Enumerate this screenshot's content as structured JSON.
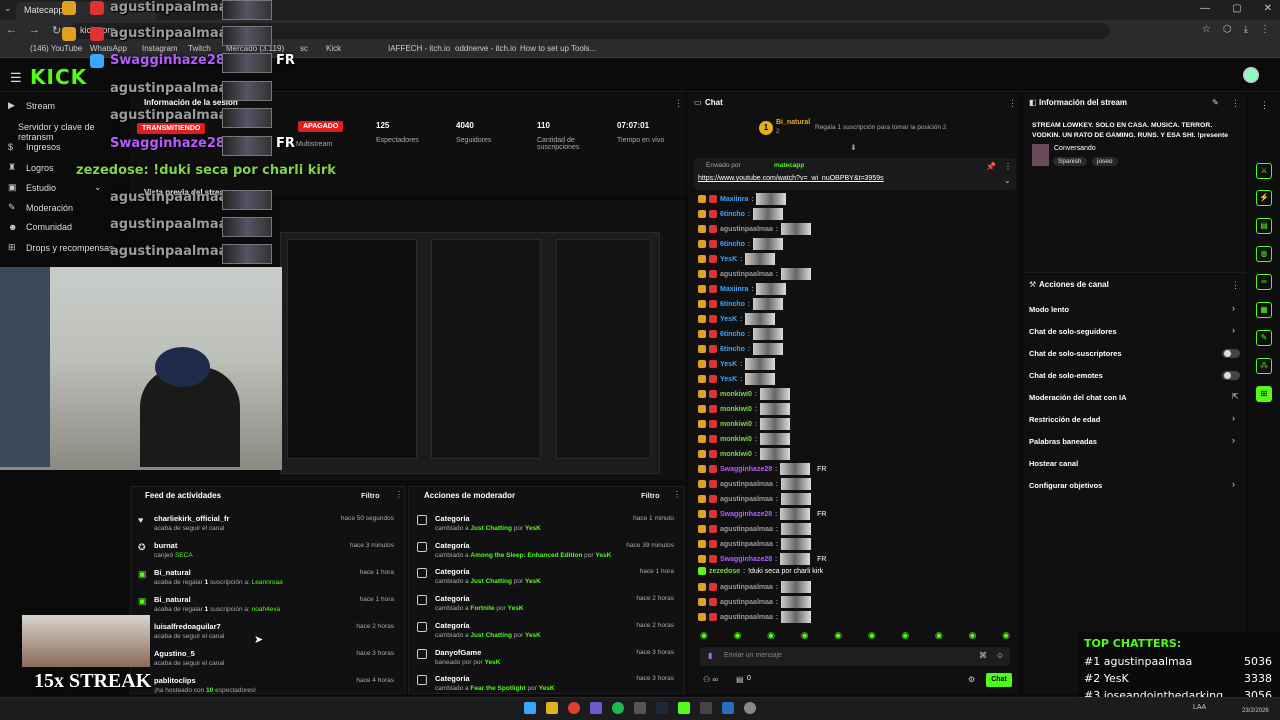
{
  "browser": {
    "tab_title": "Matecapp",
    "url_text": "kick.com",
    "bookmarks": [
      "(146) YouTube",
      "WhatsApp",
      "Instagram",
      "Twitch",
      "Mercado (3.119)",
      "sc",
      "Kick",
      "IAFFECH - itch.io",
      "oddnerve - itch.io",
      "How to set up Tools..."
    ]
  },
  "kick": {
    "logo": "KICK"
  },
  "sidebar": {
    "items": [
      {
        "label": "Stream",
        "icon": "stream-icon"
      },
      {
        "label": "Servidor y clave de retransm",
        "icon": ""
      },
      {
        "label": "Ingresos",
        "icon": "money-icon"
      },
      {
        "label": "Logros",
        "icon": "trophy-icon"
      },
      {
        "label": "Estudio",
        "icon": "studio-icon"
      },
      {
        "label": "Moderación",
        "icon": "wrench-icon"
      },
      {
        "label": "Comunidad",
        "icon": "users-icon"
      },
      {
        "label": "Drops y recompensas",
        "icon": "gift-icon"
      }
    ]
  },
  "session": {
    "title": "Información de la sesión",
    "status_live": "TRANSMITIENDO",
    "multistream_status": "APAGADO",
    "multistream_label": "Multistream",
    "stats": [
      {
        "value": "125",
        "label": "Espectadores"
      },
      {
        "value": "4040",
        "label": "Seguidores"
      },
      {
        "value": "110",
        "label": "Cantidad de suscripciones"
      },
      {
        "value": "07:07:01",
        "label": "Tiempo en vivo"
      }
    ],
    "preview_title": "Vista previa del stream"
  },
  "overlay": {
    "names": [
      "agustinpaalmaa:",
      "agustinpaalmaa:",
      "Swagginhaze28:",
      "agustinpaalmaa:",
      "agustinpaalmaa:",
      "Swagginhaze28:",
      "zezedose: !duki seca por charli kirk",
      "agustinpaalmaa:",
      "agustinpaalmaa:",
      "agustinpaalmaa:"
    ],
    "fr": "FR",
    "streak": "15x STREAK"
  },
  "activity": {
    "title": "Feed de actividades",
    "filter": "Filtro",
    "items": [
      {
        "name": "charliekirk_official_fr",
        "sub": "acaba de seguir el canal",
        "time": "hace 50 segundos",
        "icon": "heart-icon"
      },
      {
        "name": "burnat",
        "sub_pre": "canjeó",
        "sub_hl": "SECA",
        "time": "hace 3 minutos",
        "icon": "reward-icon"
      },
      {
        "name": "Bi_natural",
        "sub_pre": "acaba de regalar",
        "sub_num": "1",
        "sub_mid": "suscripción a:",
        "sub_hl": "Leannroaa",
        "time": "hace 1 hora",
        "icon": "gift-icon"
      },
      {
        "name": "Bi_natural",
        "sub_pre": "acaba de regalar",
        "sub_num": "1",
        "sub_mid": "suscripción a:",
        "sub_hl": "noah4eva",
        "time": "hace 1 hora",
        "icon": "gift-icon"
      },
      {
        "name": "luisalfredoaguilar7",
        "sub": "acaba de seguir el canal",
        "time": "hace 2 horas",
        "icon": "heart-icon"
      },
      {
        "name": "Agustino_5",
        "sub": "acaba de seguir el canal",
        "time": "hace 3 horas",
        "icon": "heart-icon"
      },
      {
        "name": "pablitoclips",
        "sub_pre": "¡ha hosteado con",
        "sub_num": "10",
        "sub_mid": "espectadores!",
        "time": "hace 4 horas",
        "icon": "host-icon"
      }
    ]
  },
  "modactions": {
    "title": "Acciones de moderador",
    "filter": "Filtro",
    "items": [
      {
        "title": "Categoría",
        "pre": "cambiado a",
        "hl": "Just Chatting",
        "by": "YesK",
        "time": "hace 1 minuto"
      },
      {
        "title": "Categoría",
        "pre": "cambiado a",
        "hl": "Among the Sleep: Enhanced Edition",
        "by": "YesK",
        "time": "hace 39 minutos"
      },
      {
        "title": "Categoría",
        "pre": "cambiado a",
        "hl": "Just Chatting",
        "by": "YesK",
        "time": "hace 1 hora"
      },
      {
        "title": "Categoría",
        "pre": "cambiado a",
        "hl": "Fortnite",
        "by": "YesK",
        "time": "hace 2 horas"
      },
      {
        "title": "Categoría",
        "pre": "cambiado a",
        "hl": "Just Chatting",
        "by": "YesK",
        "time": "hace 2 horas"
      },
      {
        "title": "DanyofGame",
        "pre": "baneado por",
        "hl": "",
        "by": "YesK",
        "time": "hace 3 horas"
      },
      {
        "title": "Categoría",
        "pre": "cambiado a",
        "hl": "Fear the Spotlight",
        "by": "YesK",
        "time": "hace 3 horas"
      }
    ]
  },
  "chat": {
    "title": "Chat",
    "gifter_name": "Bi_natural",
    "gifter_count": "2",
    "gift_prompt": "Regala 1 suscripción para tomar la posición 2",
    "pinned_by_pre": "Enviado por",
    "pinned_by": "matecapp",
    "pinned_link": "https://www.youtube.com/watch?v=_wi_nuOBPBY&t=3959s",
    "messages": [
      {
        "user": "Maxiinra",
        "color": "#3aa7ff",
        "fr": false
      },
      {
        "user": "6tincho",
        "color": "#3aa7ff",
        "fr": false
      },
      {
        "user": "agustinpaalmaa",
        "color": "#9b9b9b",
        "fr": false
      },
      {
        "user": "6tincho",
        "color": "#3aa7ff",
        "fr": false
      },
      {
        "user": "YesK",
        "color": "#3aa7ff",
        "fr": false
      },
      {
        "user": "agustinpaalmaa",
        "color": "#9b9b9b",
        "fr": false
      },
      {
        "user": "Maxiinra",
        "color": "#3aa7ff",
        "fr": false
      },
      {
        "user": "6tincho",
        "color": "#3aa7ff",
        "fr": false
      },
      {
        "user": "YesK",
        "color": "#3aa7ff",
        "fr": false
      },
      {
        "user": "6tincho",
        "color": "#3aa7ff",
        "fr": false
      },
      {
        "user": "6tincho",
        "color": "#3aa7ff",
        "fr": false
      },
      {
        "user": "YesK",
        "color": "#3aa7ff",
        "fr": false
      },
      {
        "user": "YesK",
        "color": "#3aa7ff",
        "fr": false
      },
      {
        "user": "monkiwi0",
        "color": "#7fd64a",
        "fr": false
      },
      {
        "user": "monkiwi0",
        "color": "#7fd64a",
        "fr": false
      },
      {
        "user": "monkiwi0",
        "color": "#7fd64a",
        "fr": false
      },
      {
        "user": "monkiwi0",
        "color": "#7fd64a",
        "fr": false
      },
      {
        "user": "monkiwi0",
        "color": "#7fd64a",
        "fr": false
      },
      {
        "user": "Swagginhaze28",
        "color": "#b75cff",
        "fr": true
      },
      {
        "user": "agustinpaalmaa",
        "color": "#9b9b9b",
        "fr": false
      },
      {
        "user": "agustinpaalmaa",
        "color": "#9b9b9b",
        "fr": false
      },
      {
        "user": "Swagginhaze28",
        "color": "#b75cff",
        "fr": true
      },
      {
        "user": "agustinpaalmaa",
        "color": "#9b9b9b",
        "fr": false
      },
      {
        "user": "agustinpaalmaa",
        "color": "#9b9b9b",
        "fr": false
      },
      {
        "user": "Swagginhaze28",
        "color": "#b75cff",
        "fr": true
      }
    ],
    "last_msg_user": "zezedose",
    "last_msg_text": "!duki seca por charli kirk",
    "after": [
      {
        "user": "agustinpaalmaa",
        "color": "#9b9b9b"
      },
      {
        "user": "agustinpaalmaa",
        "color": "#9b9b9b"
      },
      {
        "user": "agustinpaalmaa",
        "color": "#9b9b9b"
      }
    ],
    "input_placeholder": "Enviar un mensaje",
    "points": "0",
    "send_label": "Chat"
  },
  "stream_info": {
    "title": "Información del stream",
    "description": "STREAM LOWKEY. SOLO EN CASA. MUSICA. TERROR. VODKIN. UN RATO DE GAMING. RUNS. Y ESA SHI. !presente",
    "category": "Conversando",
    "tags": [
      "Spanish",
      "joseo"
    ]
  },
  "channel_actions": {
    "title": "Acciones de canal",
    "items": [
      {
        "label": "Modo lento",
        "control": "arrow"
      },
      {
        "label": "Chat de solo-seguidores",
        "control": "arrow"
      },
      {
        "label": "Chat de solo-suscriptores",
        "control": "toggle"
      },
      {
        "label": "Chat de solo-emotes",
        "control": "toggle"
      },
      {
        "label": "Moderación del chat con IA",
        "control": "external"
      },
      {
        "label": "Restricción de edad",
        "control": "arrow"
      },
      {
        "label": "Palabras baneadas",
        "control": "arrow"
      },
      {
        "label": "Hostear canal",
        "control": "none"
      },
      {
        "label": "Configurar objetivos",
        "control": "arrow"
      }
    ]
  },
  "top_chatters": {
    "title": "TOP CHATTERS:",
    "rows": [
      {
        "rank": "#1",
        "name": "agustinpaalmaa",
        "count": "5036"
      },
      {
        "rank": "#2",
        "name": "YesK",
        "count": "3338"
      },
      {
        "rank": "#3",
        "name": "joseandointhedarking",
        "count": "3056"
      }
    ]
  },
  "taskbar": {
    "lang": "LAA",
    "date": "23/2/2026"
  },
  "colors": {
    "accent": "#53fc18",
    "live": "#e01e1e",
    "background": "#0b0b0c"
  }
}
